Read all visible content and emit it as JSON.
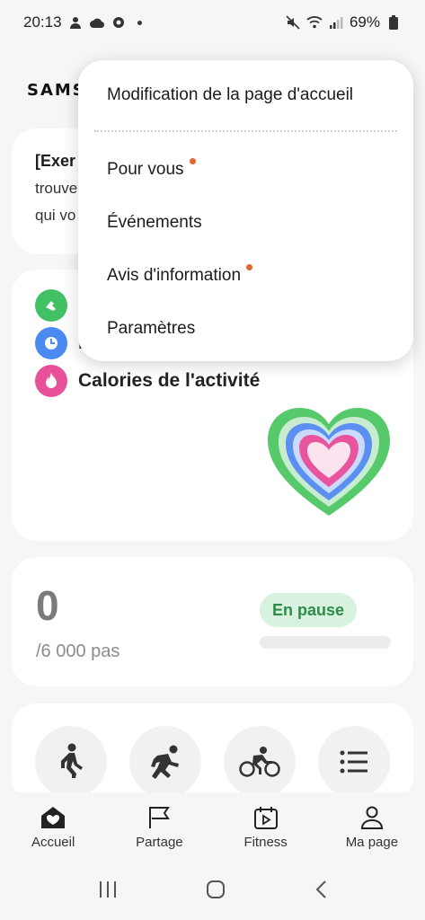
{
  "status_bar": {
    "time": "20:13",
    "battery": "69%",
    "icons_left": [
      "user-warning-icon",
      "cloud-icon",
      "settings-icon",
      "dot-icon"
    ],
    "icons_right": [
      "mute-icon",
      "wifi-icon",
      "signal-icon",
      "battery-icon"
    ]
  },
  "brand": {
    "logo_text": "SAMS"
  },
  "promo_card": {
    "title": "[Exer",
    "line1": "trouve",
    "line2": "qui vo"
  },
  "activity_card": {
    "calories_label": "Calories de l'activité",
    "metric2_label": "L"
  },
  "steps_card": {
    "value": "0",
    "goal": "/6 000 pas",
    "status": "En pause",
    "progress": 0
  },
  "bottom_nav": {
    "items": [
      {
        "label": "Accueil",
        "icon": "home-heart-icon"
      },
      {
        "label": "Partage",
        "icon": "flag-icon"
      },
      {
        "label": "Fitness",
        "icon": "calendar-play-icon"
      },
      {
        "label": "Ma page",
        "icon": "person-icon"
      }
    ]
  },
  "overflow_menu": {
    "items": [
      {
        "label": "Modification de la page d'accueil",
        "badge": false
      },
      {
        "label": "Pour vous",
        "badge": true
      },
      {
        "label": "Événements",
        "badge": false
      },
      {
        "label": "Avis d'information",
        "badge": true
      },
      {
        "label": "Paramètres",
        "badge": false
      }
    ]
  },
  "colors": {
    "steps_green": "#42c064",
    "time_blue": "#4b8af0",
    "calories_pink": "#e8509a",
    "badge_orange": "#e2662f"
  }
}
